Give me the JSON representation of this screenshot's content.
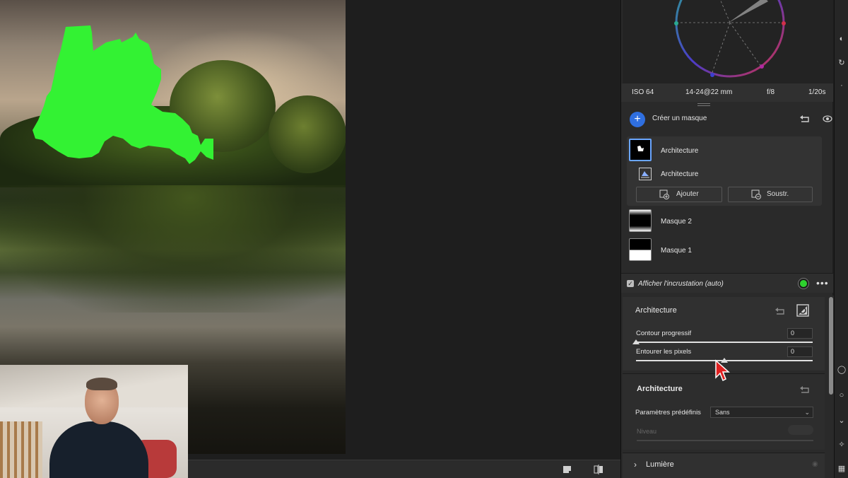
{
  "exif": {
    "iso": "ISO 64",
    "lens": "14-24@22 mm",
    "aperture": "f/8",
    "shutter": "1/20s"
  },
  "masks_header": {
    "create_label": "Créer un masque",
    "plus": "+"
  },
  "mask_group": {
    "main_label": "Architecture",
    "sub_label": "Architecture",
    "add_label": "Ajouter",
    "subtract_label": "Soustr."
  },
  "masks": [
    {
      "label": "Masque 2"
    },
    {
      "label": "Masque 1"
    }
  ],
  "overlay": {
    "label": "Afficher l'incrustation (auto)",
    "checked": true,
    "overlay_color": "#2ed12e",
    "more": "•••"
  },
  "architecture_panel": {
    "title": "Architecture",
    "feather_label": "Contour progressif",
    "feather_value": "0",
    "feather_level": 0,
    "refine_label": "Entourer les pixels",
    "refine_value": "0",
    "refine_level": 0.5
  },
  "architecture_adjust": {
    "title": "Architecture",
    "preset_label": "Paramètres prédéfinis",
    "preset_value": "Sans",
    "amount_label": "Niveau"
  },
  "lumiere": {
    "label": "Lumière"
  },
  "colors": {
    "accent": "#2f6fe0",
    "selection": "#6aa6ff",
    "cursor": "#e02020"
  }
}
